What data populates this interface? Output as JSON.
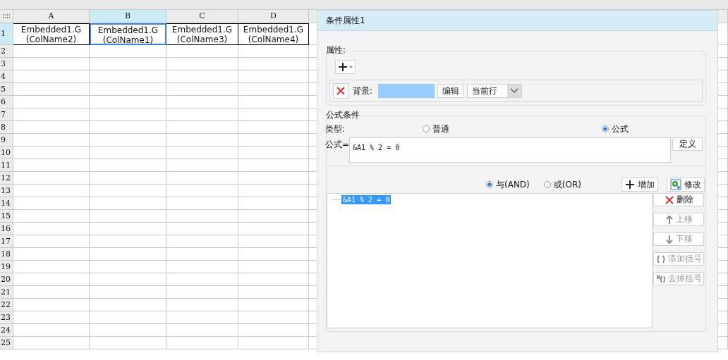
{
  "sheet": {
    "columns": [
      {
        "label": "A",
        "selected": false
      },
      {
        "label": "B",
        "selected": true
      },
      {
        "label": "C",
        "selected": false
      },
      {
        "label": "D",
        "selected": false
      }
    ],
    "rows": [
      {
        "label": "1",
        "selected": true,
        "cells": [
          {
            "text": "Embedded1.G(ColName2)",
            "selected": false
          },
          {
            "text": "Embedded1.G(ColName1)",
            "selected": true
          },
          {
            "text": "Embedded1.G(ColName3)",
            "selected": false
          },
          {
            "text": "Embedded1.G(ColName4)",
            "selected": false
          }
        ]
      },
      {
        "label": "2",
        "selected": false
      },
      {
        "label": "3",
        "selected": false
      },
      {
        "label": "4",
        "selected": false
      },
      {
        "label": "5",
        "selected": false
      },
      {
        "label": "6",
        "selected": false
      },
      {
        "label": "7",
        "selected": false
      },
      {
        "label": "8",
        "selected": false
      },
      {
        "label": "9",
        "selected": false
      },
      {
        "label": "10",
        "selected": false
      },
      {
        "label": "11",
        "selected": false
      },
      {
        "label": "12",
        "selected": false
      },
      {
        "label": "13",
        "selected": false
      },
      {
        "label": "14",
        "selected": false
      },
      {
        "label": "15",
        "selected": false
      },
      {
        "label": "16",
        "selected": false
      },
      {
        "label": "17",
        "selected": false
      },
      {
        "label": "18",
        "selected": false
      },
      {
        "label": "19",
        "selected": false
      },
      {
        "label": "20",
        "selected": false
      },
      {
        "label": "21",
        "selected": false
      },
      {
        "label": "22",
        "selected": false
      },
      {
        "label": "23",
        "selected": false
      },
      {
        "label": "24",
        "selected": false
      },
      {
        "label": "25",
        "selected": false
      }
    ]
  },
  "panel": {
    "title": "条件属性1",
    "properties": {
      "legend": "属性:",
      "items": [
        {
          "label": "背景:",
          "color": "#99ccff",
          "edit_button": "编辑",
          "scope": "当前行"
        }
      ]
    },
    "formula_condition": {
      "legend": "公式条件",
      "type_label": "类型:",
      "type_options": [
        {
          "label": "普通",
          "selected": false
        },
        {
          "label": "公式",
          "selected": true
        }
      ],
      "formula_label": "公式=",
      "formula_value": "&A1 % 2 = 0",
      "define_button": "定义",
      "logic_options": [
        {
          "label": "与(AND)",
          "selected": true
        },
        {
          "label": "或(OR)",
          "selected": false
        }
      ],
      "add_button": "增加",
      "modify_button": "修改",
      "conditions": [
        {
          "text": "&A1 % 2 = 0",
          "selected": true
        }
      ],
      "side_buttons": [
        {
          "kind": "delete",
          "label": "删除",
          "disabled": false
        },
        {
          "kind": "up",
          "label": "上移",
          "disabled": true
        },
        {
          "kind": "down",
          "label": "下移",
          "disabled": true
        },
        {
          "kind": "add-brackets",
          "label": "添加括号",
          "disabled": true
        },
        {
          "kind": "remove-brackets",
          "label": "去掉括号",
          "disabled": true
        }
      ]
    }
  }
}
